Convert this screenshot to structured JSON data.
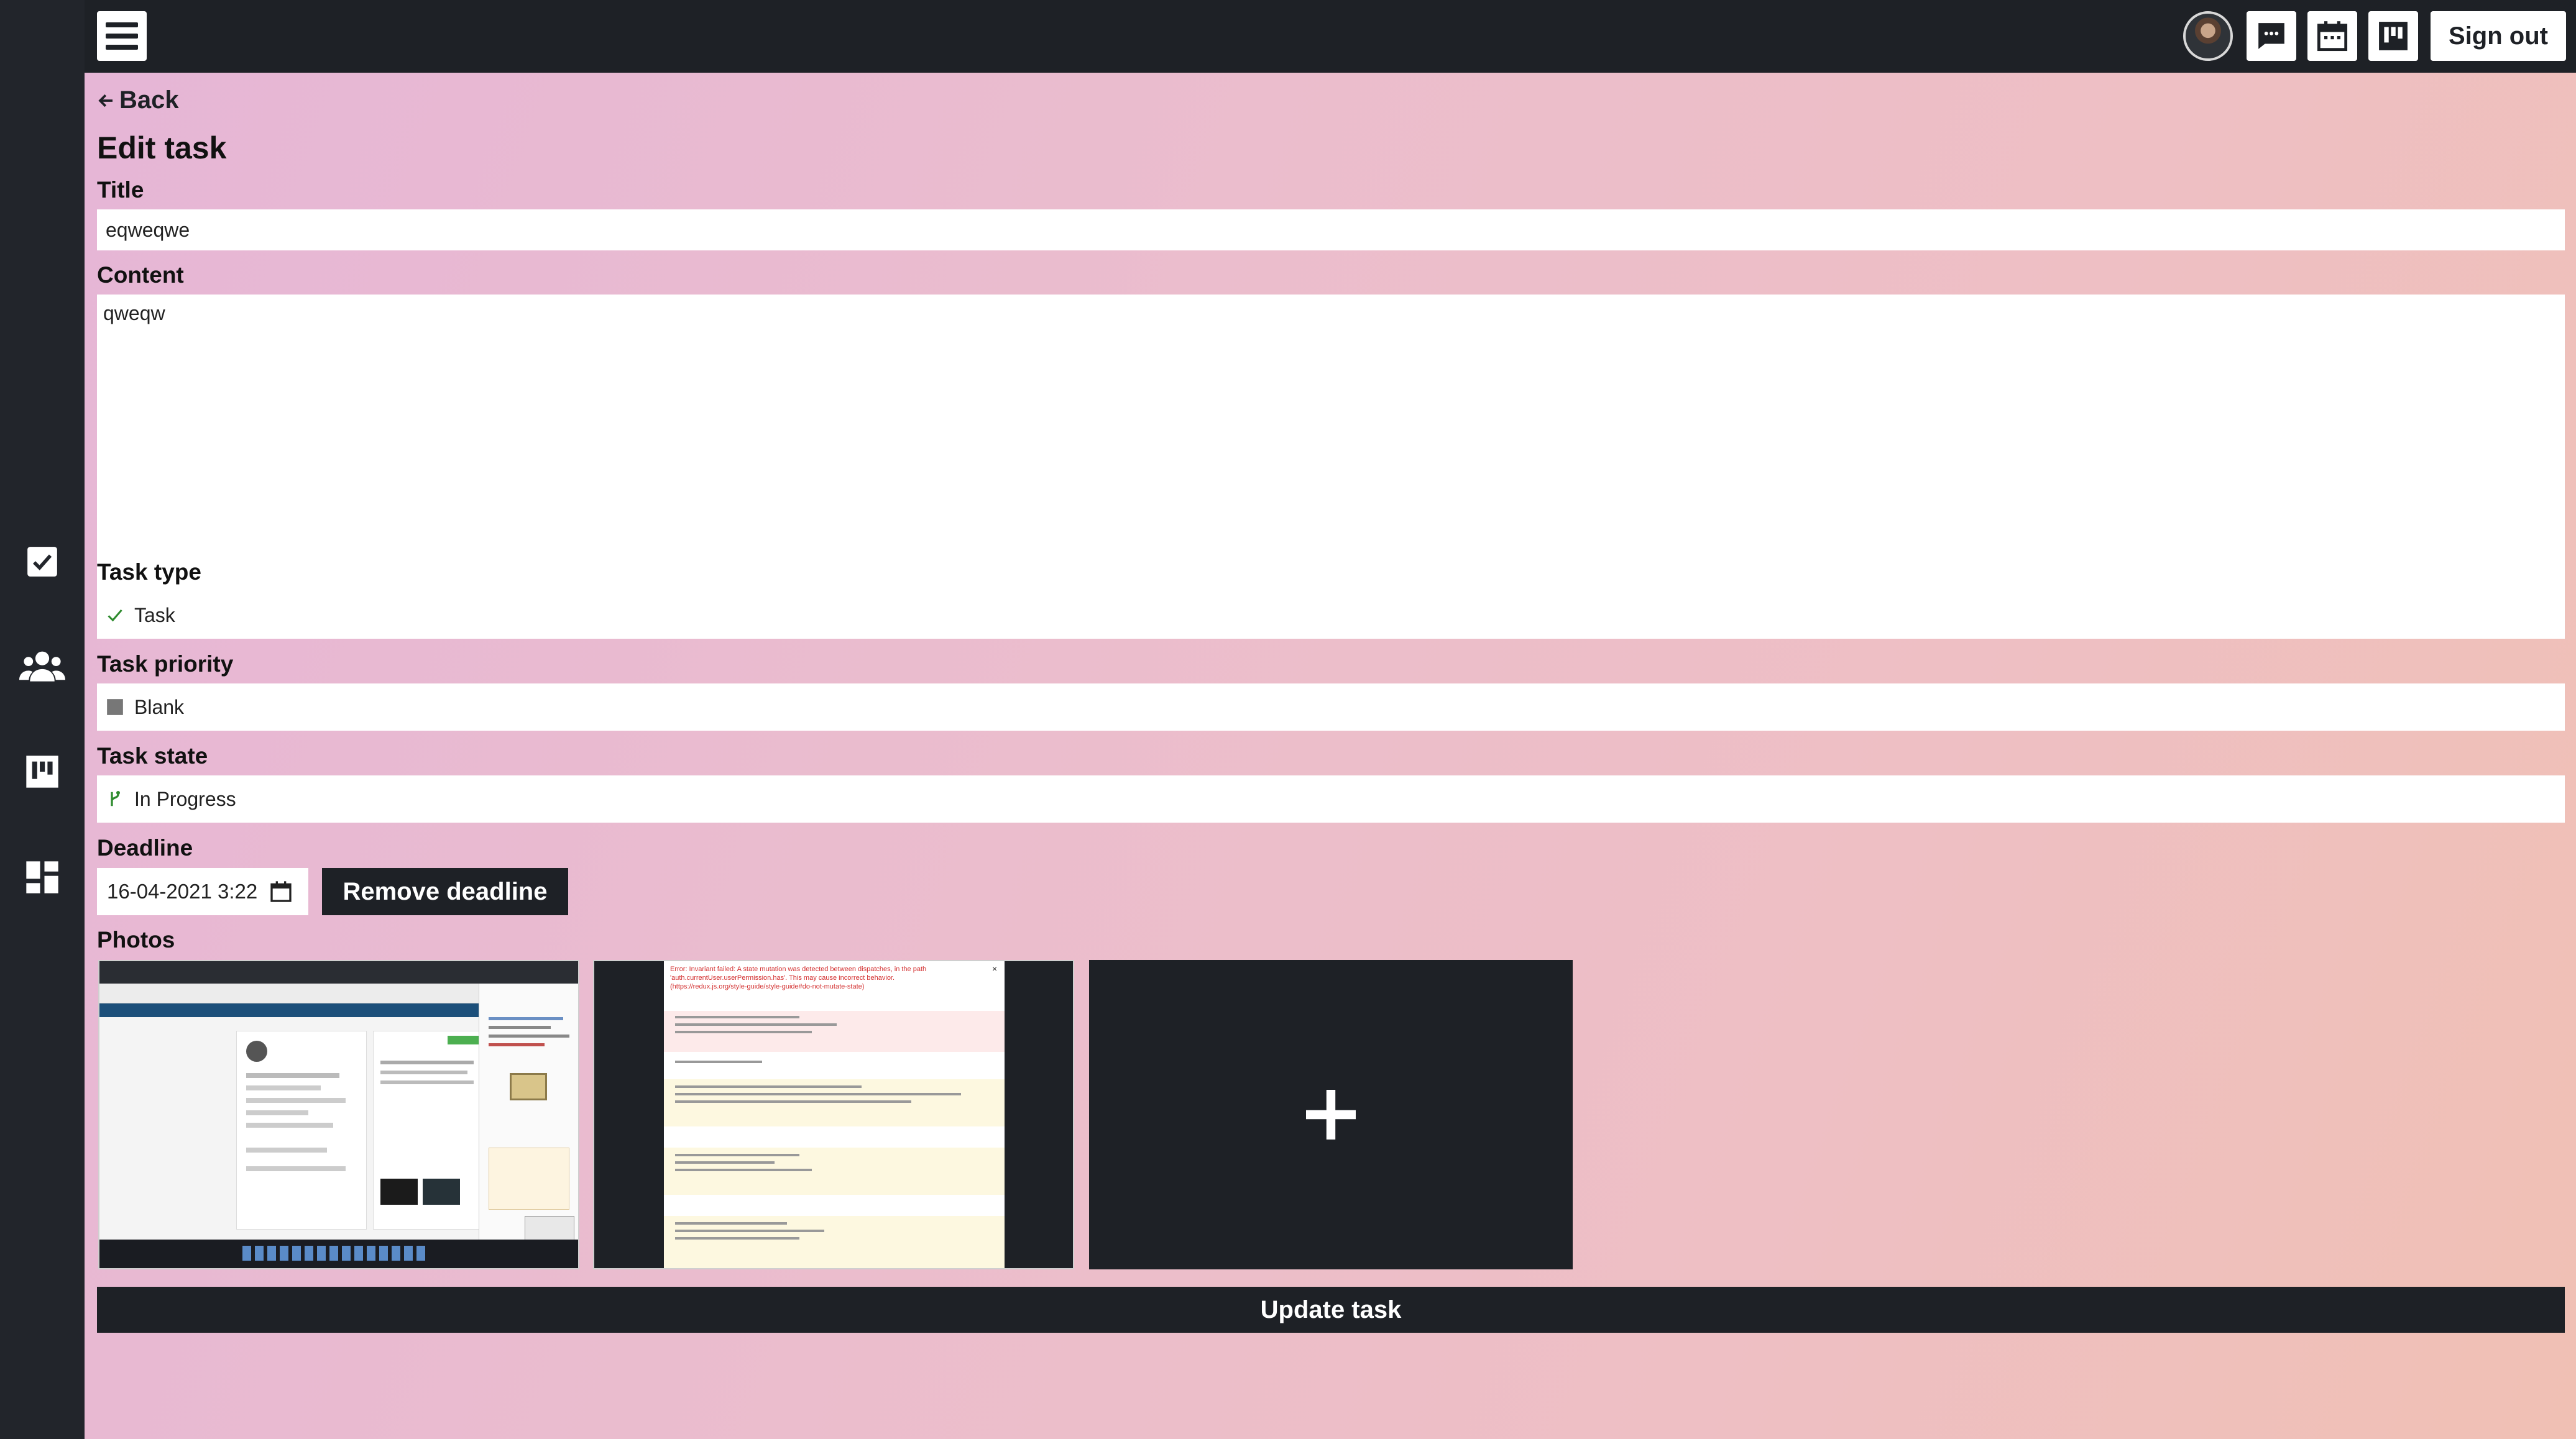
{
  "topbar": {
    "menu_icon": "hamburger-menu-icon",
    "avatar_icon": "user-avatar",
    "icons": [
      "chat-icon",
      "calendar-icon",
      "kanban-icon"
    ],
    "sign_out_label": "Sign out"
  },
  "sidebar": {
    "items": [
      {
        "icon": "checkbox-icon"
      },
      {
        "icon": "users-icon"
      },
      {
        "icon": "kanban-icon"
      },
      {
        "icon": "dashboard-icon"
      }
    ]
  },
  "form": {
    "back_label": "Back",
    "page_title": "Edit task",
    "title_label": "Title",
    "title_value": "eqweqwe",
    "content_label": "Content",
    "content_value": "qweqw",
    "task_type_label": "Task type",
    "task_type_value": "Task",
    "task_priority_label": "Task priority",
    "task_priority_value": "Blank",
    "task_state_label": "Task state",
    "task_state_value": "In Progress",
    "deadline_label": "Deadline",
    "deadline_value": "16-04-2021 3:22",
    "remove_deadline_label": "Remove deadline",
    "photos_label": "Photos",
    "photos": [
      {
        "icon": "screenshot-thumbnail-1"
      },
      {
        "icon": "screenshot-thumbnail-2",
        "error_text": "Error: Invariant failed: A state mutation was detected between dispatches, in the path 'auth.currentUser.userPermission.has'. This may cause incorrect behavior. (https://redux.js.org/style-guide/style-guide#do-not-mutate-state)"
      },
      {
        "icon": "add-photo-icon"
      }
    ],
    "update_label": "Update task"
  },
  "colors": {
    "dark": "#1e2126",
    "gradient_left": "#e6b6d6",
    "gradient_right": "#f0c0b4",
    "state_green": "#2e8b2e",
    "priority_gray": "#777777"
  }
}
